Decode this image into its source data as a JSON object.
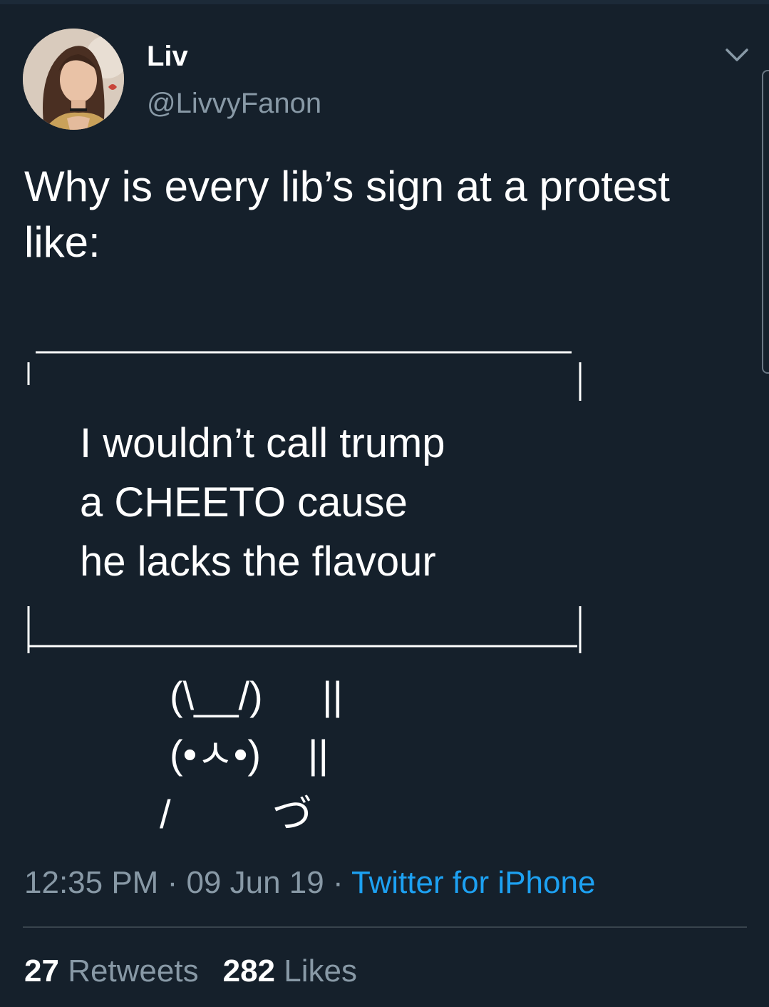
{
  "user": {
    "display_name": "Liv",
    "handle": "@LivvyFanon",
    "avatar_icon": "profile-photo"
  },
  "tweet": {
    "text": "Why is every lib’s sign at a protest like:",
    "sign_text": "I wouldn’t call trump\na CHEETO cause\nhe lacks the flavour",
    "bunny": {
      "ears": "(\\__/)",
      "ears_pole": "||",
      "face": "(•ㅅ•)",
      "face_pole": "||",
      "arm": "/",
      "hand": "づ"
    }
  },
  "meta": {
    "time": "12:35 PM",
    "separator": " · ",
    "date": "09 Jun 19",
    "source": "Twitter for iPhone"
  },
  "stats": {
    "retweets_count": "27",
    "retweets_label": "Retweets",
    "likes_count": "282",
    "likes_label": "Likes"
  },
  "colors": {
    "background": "#15202b",
    "text": "#ffffff",
    "secondary": "#8899a6",
    "accent": "#1da1f2",
    "divider": "#38444d"
  },
  "icons": {
    "more": "chevron-down-icon"
  }
}
